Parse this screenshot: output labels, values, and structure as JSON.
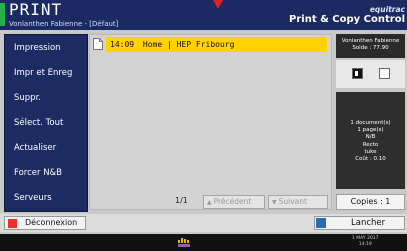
{
  "header": {
    "title": "PRINT",
    "subtitle": "Vonlanthen Fabienne - [Défaut]",
    "brand_name": "equitrac",
    "brand_tagline": "Print & Copy Control"
  },
  "sidebar": {
    "items": [
      {
        "label": "Impression"
      },
      {
        "label": "Impr et Enreg"
      },
      {
        "label": "Suppr."
      },
      {
        "label": "Sélect. Tout"
      },
      {
        "label": "Actualiser"
      },
      {
        "label": "Forcer N&B"
      },
      {
        "label": "Serveurs"
      }
    ]
  },
  "jobs": [
    {
      "time": "14:09",
      "name": "Home | HEP Fribourg",
      "selected": true
    }
  ],
  "account": {
    "name": "Vonlanthen Fabienne",
    "balance": "Solde : 77.90"
  },
  "summary": {
    "documents": "1 document(s)",
    "pages": "1 page(s)",
    "color": "N/B",
    "sides": "Recto",
    "paper": "tuke",
    "cost": "Coût : 0.10"
  },
  "pager": {
    "count": "1/1",
    "prev_label": "Précédent",
    "next_label": "Suivant"
  },
  "copies": {
    "label": "Copies : 1"
  },
  "actions": {
    "logout_label": "Déconnexion",
    "launch_label": "Lancher"
  },
  "status": {
    "date": "1 MAY 2017",
    "time": "14:19"
  },
  "colors": {
    "header": "#1b2a63",
    "sidebar": "#1c2c63",
    "selection": "#ffd200",
    "accent_green": "#22b24c",
    "logout_red": "#e8332a"
  },
  "icons": {
    "document": "document-icon",
    "logout": "logout-icon",
    "launch": "launch-icon",
    "print_mode": "toggle-icon"
  }
}
